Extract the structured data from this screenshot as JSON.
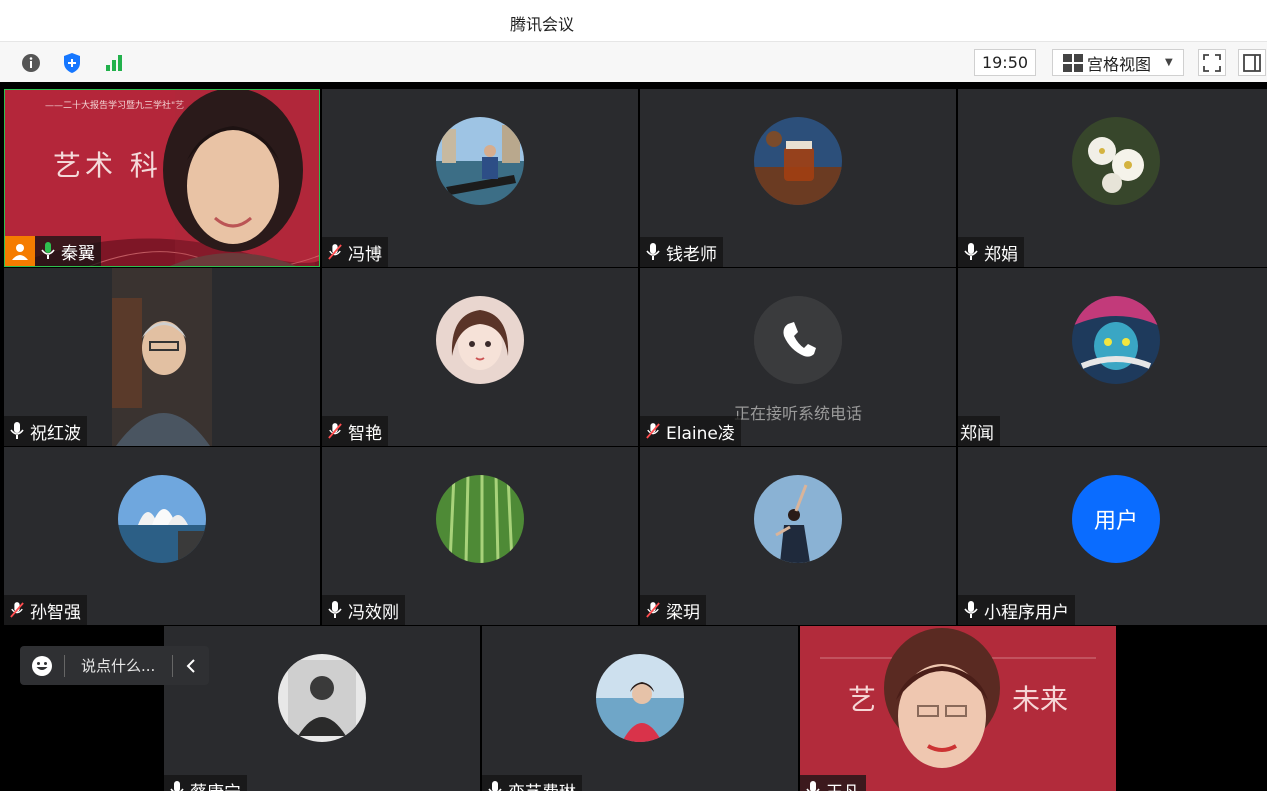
{
  "window": {
    "title": "腾讯会议"
  },
  "toolbar": {
    "info_icon": "info-icon",
    "security_icon": "shield-icon",
    "signal_icon": "signal-icon",
    "time": "19:50",
    "view_label": "宫格视图",
    "fullscreen_icon": "fullscreen-icon",
    "sidebar_icon": "sidebar-toggle-icon"
  },
  "colors": {
    "accent_green": "#2fbf4f",
    "tile_bg": "#2a2b2e",
    "user_avatar_blue": "#0a6cff",
    "host_badge": "#f57c00"
  },
  "participants": [
    {
      "name": "秦翼",
      "mic": "on",
      "video": true,
      "host": true,
      "slide_text": "艺术 科",
      "slide_header": "——二十大报告学习暨九三学社\"艺"
    },
    {
      "name": "冯博",
      "mic": "muted"
    },
    {
      "name": "钱老师",
      "mic": "on"
    },
    {
      "name": "郑娟",
      "mic": "on"
    },
    {
      "name": "祝红波",
      "mic": "on",
      "video": true
    },
    {
      "name": "智艳",
      "mic": "muted"
    },
    {
      "name": "Elaine凌",
      "mic": "muted",
      "status": "正在接听系统电话"
    },
    {
      "name": "郑闻",
      "mic": "none"
    },
    {
      "name": "孙智强",
      "mic": "muted"
    },
    {
      "name": "冯效刚",
      "mic": "on"
    },
    {
      "name": "梁玥",
      "mic": "muted"
    },
    {
      "name": "小程序用户",
      "mic": "on",
      "avatar_text": "用户"
    },
    {
      "name": "蔡康宁",
      "mic": "on"
    },
    {
      "name": "恋艺费琳",
      "mic": "on"
    },
    {
      "name": "王凡",
      "mic": "on",
      "video": true,
      "slide_text": "艺",
      "slide_text2": "未来"
    }
  ],
  "chat": {
    "placeholder": "说点什么...",
    "emoji_icon": "emoji-icon",
    "collapse_icon": "chevron-left-icon"
  }
}
